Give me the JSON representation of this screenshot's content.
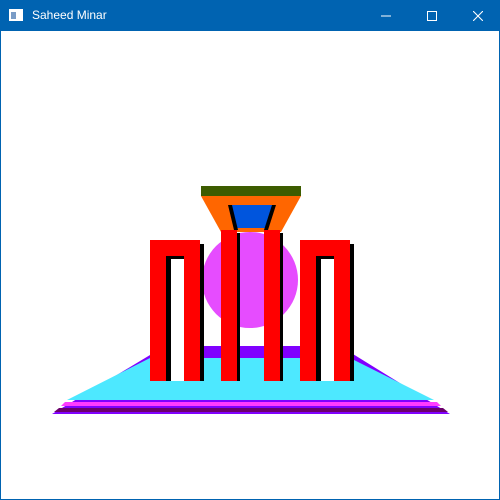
{
  "window": {
    "title": "Saheed Minar",
    "icon": "app-window-icon",
    "controls": [
      {
        "name": "minimize-button",
        "icon": "minimize-icon"
      },
      {
        "name": "maximize-button",
        "icon": "maximize-icon"
      },
      {
        "name": "close-button",
        "icon": "close-icon"
      }
    ],
    "titlebar_color": "#0063b1"
  },
  "scene": {
    "background": "#ffffff",
    "colors": {
      "platform_top": "#4de8ff",
      "platform_side": "#8000ff",
      "platform_stripe_magenta": "#ff3cff",
      "platform_stripe_dark": "#6b006b",
      "sun": "#e64cff",
      "pillar": "#ff0000",
      "shadow": "#000000",
      "top_band": "#ff6600",
      "top_cap": "#3d5c00",
      "top_window": "#0055dd"
    }
  }
}
